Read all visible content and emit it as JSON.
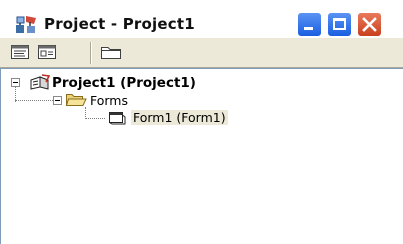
{
  "window": {
    "title": "Project - Project1",
    "app_icon": "project-explorer-icon",
    "buttons": {
      "minimize_icon": "minimize-icon",
      "maximize_icon": "maximize-icon",
      "close_icon": "close-icon"
    }
  },
  "toolbar": {
    "buttons": [
      {
        "name": "view-code-button",
        "icon": "view-code-icon"
      },
      {
        "name": "view-object-button",
        "icon": "view-object-icon"
      },
      {
        "name": "toggle-folders-button",
        "icon": "folder-icon"
      }
    ]
  },
  "tree": {
    "root": {
      "label": "Project1 (Project1)",
      "icon": "project-icon",
      "expanded": true
    },
    "folder": {
      "label": "Forms",
      "icon": "folder-open-icon",
      "expanded": true
    },
    "item": {
      "label": "Form1 (Form1)",
      "icon": "form-icon",
      "selected": true
    }
  },
  "colors": {
    "selection": "#ece9d8",
    "title_text": "#111111",
    "close_button": "#c9401e",
    "caption_button": "#1a5fe0"
  }
}
